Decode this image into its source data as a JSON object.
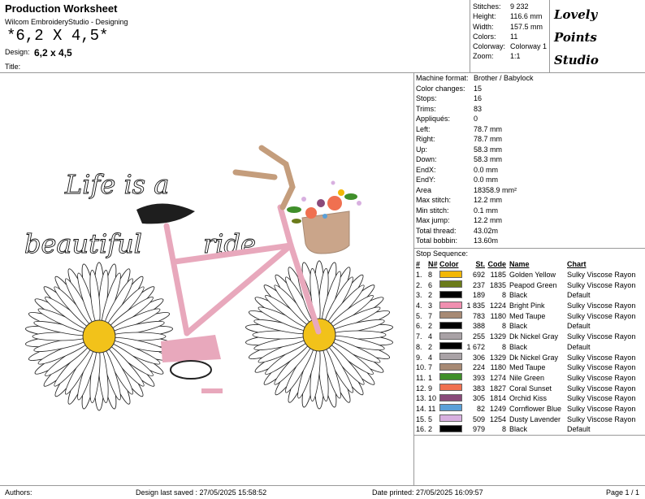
{
  "header": {
    "title": "Production Worksheet",
    "app": "Wilcom EmbroideryStudio - Designing",
    "design_name": "*6,2 X 4,5*",
    "design_label": "Design:",
    "design_value": "6,2 x 4,5",
    "title_label": "Title:"
  },
  "stats": [
    {
      "k": "Stitches:",
      "v": "9 232"
    },
    {
      "k": "Height:",
      "v": "116.6 mm"
    },
    {
      "k": "Width:",
      "v": "157.5 mm"
    },
    {
      "k": "Colors:",
      "v": "11"
    },
    {
      "k": "Colorway:",
      "v": "Colorway 1"
    },
    {
      "k": "Zoom:",
      "v": "1:1"
    }
  ],
  "logo": [
    "Lovely",
    "Points",
    "Studio"
  ],
  "artwork_text": {
    "line1": "Life is a",
    "line2a": "beautiful",
    "line2b": "ride"
  },
  "info": [
    {
      "k": "Machine format:",
      "v": "Brother / Babylock"
    },
    {
      "k": "Color changes:",
      "v": "15"
    },
    {
      "k": "Stops:",
      "v": "16"
    },
    {
      "k": "Trims:",
      "v": "83"
    },
    {
      "k": "Appliqués:",
      "v": "0"
    },
    {
      "k": "Left:",
      "v": "78.7 mm"
    },
    {
      "k": "Right:",
      "v": "78.7 mm"
    },
    {
      "k": "Up:",
      "v": "58.3 mm"
    },
    {
      "k": "Down:",
      "v": "58.3 mm"
    },
    {
      "k": "EndX:",
      "v": "0.0 mm"
    },
    {
      "k": "EndY:",
      "v": "0.0 mm"
    },
    {
      "k": "Area",
      "v": "18358.9 mm²"
    },
    {
      "k": "Max stitch:",
      "v": "12.2 mm"
    },
    {
      "k": "Min stitch:",
      "v": "0.1 mm"
    },
    {
      "k": "Max jump:",
      "v": "12.2 mm"
    },
    {
      "k": "Total thread:",
      "v": "43.02m"
    },
    {
      "k": "Total bobbin:",
      "v": "13.60m"
    }
  ],
  "stop_sequence": {
    "title": "Stop Sequence:",
    "headers": {
      "num": "#",
      "n": "N#",
      "color": "Color",
      "st": "St.",
      "code": "Code",
      "name": "Name",
      "chart": "Chart"
    },
    "rows": [
      {
        "num": "1.",
        "n": "8",
        "color": "#f2b705",
        "st": "692",
        "code": "1185",
        "name": "Golden Yellow",
        "chart": "Sulky Viscose Rayon"
      },
      {
        "num": "2.",
        "n": "6",
        "color": "#6b7b1a",
        "st": "237",
        "code": "1835",
        "name": "Peapod Green",
        "chart": "Sulky Viscose Rayon"
      },
      {
        "num": "3.",
        "n": "2",
        "color": "#000000",
        "st": "189",
        "code": "8",
        "name": "Black",
        "chart": "Default"
      },
      {
        "num": "4.",
        "n": "3",
        "color": "#f08fb0",
        "st": "1 835",
        "code": "1224",
        "name": "Bright Pink",
        "chart": "Sulky Viscose Rayon"
      },
      {
        "num": "5.",
        "n": "7",
        "color": "#a78a74",
        "st": "783",
        "code": "1180",
        "name": "Med Taupe",
        "chart": "Sulky Viscose Rayon"
      },
      {
        "num": "6.",
        "n": "2",
        "color": "#000000",
        "st": "388",
        "code": "8",
        "name": "Black",
        "chart": "Default"
      },
      {
        "num": "7.",
        "n": "4",
        "color": "#a9a2a6",
        "st": "255",
        "code": "1329",
        "name": "Dk Nickel Gray",
        "chart": "Sulky Viscose Rayon"
      },
      {
        "num": "8.",
        "n": "2",
        "color": "#000000",
        "st": "1 672",
        "code": "8",
        "name": "Black",
        "chart": "Default"
      },
      {
        "num": "9.",
        "n": "4",
        "color": "#a9a2a6",
        "st": "306",
        "code": "1329",
        "name": "Dk Nickel Gray",
        "chart": "Sulky Viscose Rayon"
      },
      {
        "num": "10.",
        "n": "7",
        "color": "#a78a74",
        "st": "224",
        "code": "1180",
        "name": "Med Taupe",
        "chart": "Sulky Viscose Rayon"
      },
      {
        "num": "11.",
        "n": "1",
        "color": "#3f8f2a",
        "st": "393",
        "code": "1274",
        "name": "Nile Green",
        "chart": "Sulky Viscose Rayon"
      },
      {
        "num": "12.",
        "n": "9",
        "color": "#f07050",
        "st": "383",
        "code": "1827",
        "name": "Coral Sunset",
        "chart": "Sulky Viscose Rayon"
      },
      {
        "num": "13.",
        "n": "10",
        "color": "#8a4a7a",
        "st": "305",
        "code": "1814",
        "name": "Orchid Kiss",
        "chart": "Sulky Viscose Rayon"
      },
      {
        "num": "14.",
        "n": "11",
        "color": "#5aa0d8",
        "st": "82",
        "code": "1249",
        "name": "Cornflower Blue",
        "chart": "Sulky Viscose Rayon"
      },
      {
        "num": "15.",
        "n": "5",
        "color": "#d8b0e0",
        "st": "509",
        "code": "1254",
        "name": "Dusty Lavender",
        "chart": "Sulky Viscose Rayon"
      },
      {
        "num": "16.",
        "n": "2",
        "color": "#000000",
        "st": "979",
        "code": "8",
        "name": "Black",
        "chart": "Default"
      }
    ]
  },
  "footer": {
    "authors": "Authors:",
    "last_saved": "Design last saved : 27/05/2025 15:58:52",
    "printed": "Date printed: 27/05/2025 16:09:57",
    "page": "Page 1 / 1"
  }
}
